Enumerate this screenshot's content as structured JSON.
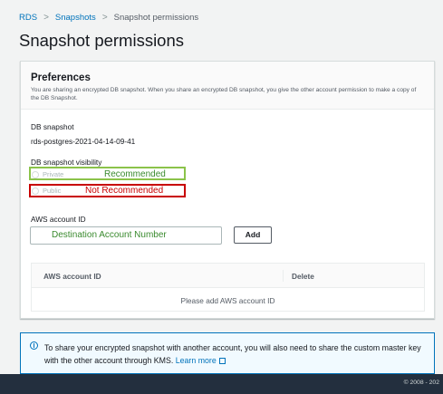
{
  "breadcrumb": {
    "items": [
      "RDS",
      "Snapshots",
      "Snapshot permissions"
    ],
    "separator": ">"
  },
  "page": {
    "title": "Snapshot permissions"
  },
  "preferences": {
    "title": "Preferences",
    "description": "You are sharing an encrypted DB snapshot. When you share an encrypted DB snapshot, you give the other account permission to make a copy of the DB Snapshot.",
    "db_snapshot_label": "DB snapshot",
    "db_snapshot_value": "rds-postgres-2021-04-14-09-41",
    "visibility_label": "DB snapshot visibility",
    "visibility_options": [
      "Private",
      "Public"
    ],
    "annotations": {
      "private": "Recommended",
      "public": "Not Recommended"
    },
    "account_id_label": "AWS account ID",
    "account_id_input_value": "Destination Account Number",
    "add_button": "Add",
    "table": {
      "columns": [
        "AWS account ID",
        "Delete"
      ],
      "empty_message": "Please add AWS account ID"
    }
  },
  "info": {
    "text": "To share your encrypted snapshot with another account, you will also need to share the custom master key with the other account through KMS.",
    "link": "Learn more"
  },
  "footer": {
    "text": "© 2008 - 202"
  },
  "colors": {
    "link": "#0073bb",
    "recommended": "#8bc34a",
    "not_recommended": "#c80000",
    "footer_bg": "#232f3e"
  }
}
